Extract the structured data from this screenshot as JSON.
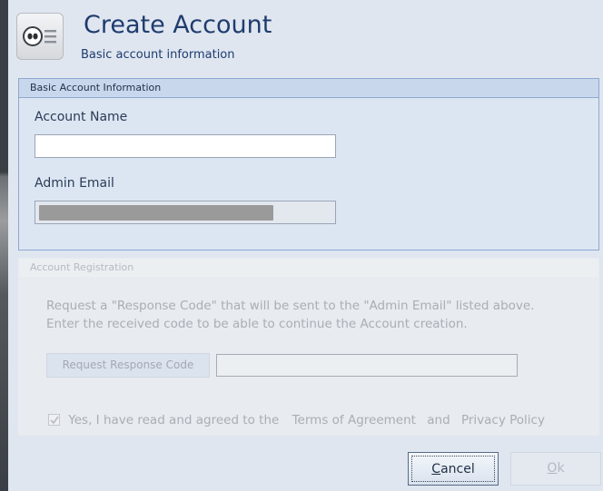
{
  "dialog": {
    "title": "Create Account",
    "subtitle": "Basic account information",
    "icon": "chat-bubble-eyes-icon"
  },
  "basic_group": {
    "header": "Basic Account Information",
    "account_name_label": "Account Name",
    "account_name_value": "",
    "admin_email_label": "Admin Email",
    "admin_email_redacted": true
  },
  "registration_group": {
    "header": "Account Registration",
    "description_line1": "Request a \"Response Code\" that will be sent to the \"Admin Email\" listed above.",
    "description_line2": "Enter the received code to be able to continue the Account creation.",
    "request_button_label": "Request Response Code",
    "response_code_value": "",
    "agree_text": "Yes, I have read and agreed to the",
    "terms_link": "Terms of Agreement",
    "and_text": "and",
    "privacy_link": "Privacy Policy",
    "agree_checked": true,
    "enabled": false
  },
  "footer": {
    "cancel_label_first": "C",
    "cancel_label_rest": "ancel",
    "ok_label_first": "O",
    "ok_label_rest": "k"
  },
  "colors": {
    "dialog_bg": "#dfe6f0",
    "title": "#1f3c6e",
    "group_border": "#8ea8cf",
    "disabled_text": "#a9aeb5"
  }
}
